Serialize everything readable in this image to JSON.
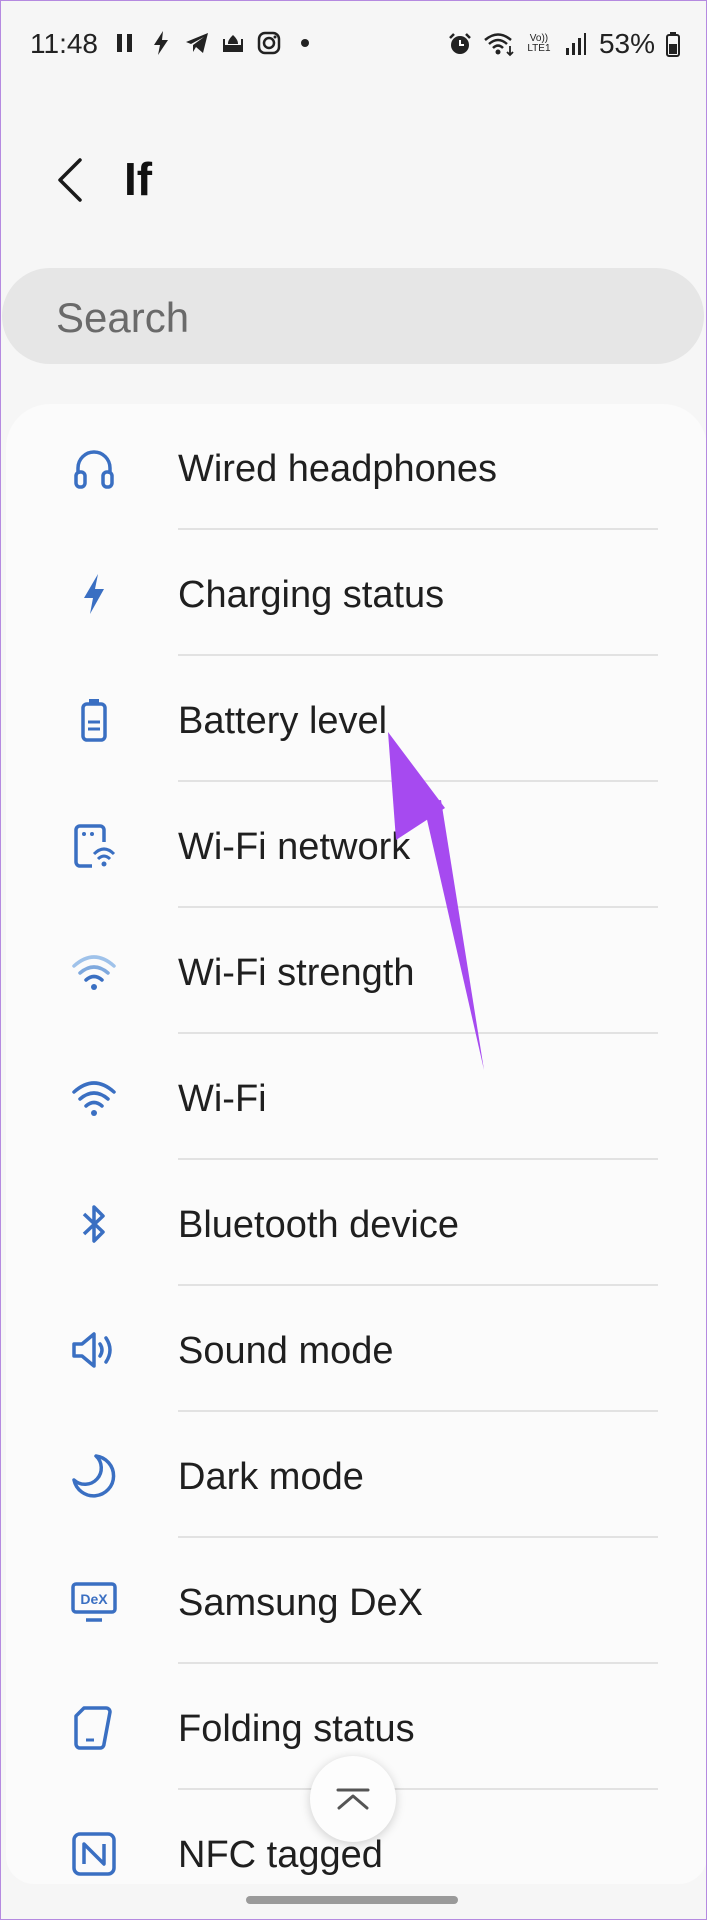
{
  "status_bar": {
    "time": "11:48",
    "battery_percent": "53%",
    "left_icons": [
      "pause-icon",
      "flash-icon",
      "telegram-icon",
      "mosque-icon",
      "instagram-icon",
      "dot-icon"
    ],
    "right_icons": [
      "alarm-icon",
      "wifi-icon",
      "volte-icon",
      "signal-icon",
      "battery-icon"
    ],
    "volte_label": "Vo)) LTE1"
  },
  "header": {
    "title": "If"
  },
  "search": {
    "placeholder": "Search"
  },
  "list": {
    "items": [
      {
        "label": "Wired headphones",
        "icon": "headphones-icon"
      },
      {
        "label": "Charging status",
        "icon": "bolt-icon"
      },
      {
        "label": "Battery level",
        "icon": "battery-icon"
      },
      {
        "label": "Wi-Fi network",
        "icon": "wifi-network-icon"
      },
      {
        "label": "Wi-Fi strength",
        "icon": "wifi-strength-icon"
      },
      {
        "label": "Wi-Fi",
        "icon": "wifi-icon"
      },
      {
        "label": "Bluetooth device",
        "icon": "bluetooth-icon"
      },
      {
        "label": "Sound mode",
        "icon": "speaker-icon"
      },
      {
        "label": "Dark mode",
        "icon": "moon-icon"
      },
      {
        "label": "Samsung DeX",
        "icon": "dex-icon"
      },
      {
        "label": "Folding status",
        "icon": "fold-icon"
      },
      {
        "label": "NFC tagged",
        "icon": "nfc-icon"
      }
    ]
  },
  "dex_icon_text": "DeX",
  "colors": {
    "icon_blue": "#3a6fc2",
    "icon_blue_light": "#9fc2ea",
    "annotation_arrow": "#a64af0",
    "background": "#f6f6f6"
  }
}
